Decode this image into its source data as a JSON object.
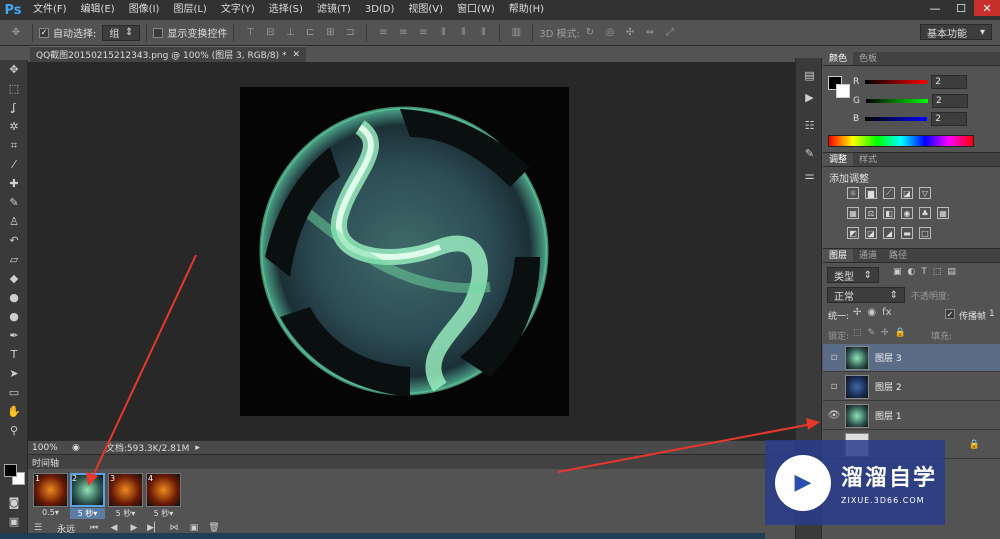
{
  "app": {
    "logo": "Ps",
    "window_controls": [
      "—",
      "☐",
      "✕"
    ]
  },
  "menu": [
    "文件(F)",
    "编辑(E)",
    "图像(I)",
    "图层(L)",
    "文字(Y)",
    "选择(S)",
    "滤镜(T)",
    "3D(D)",
    "视图(V)",
    "窗口(W)",
    "帮助(H)"
  ],
  "options": {
    "auto_select_label": "自动选择:",
    "auto_select_checked": true,
    "auto_select_target": "组",
    "show_transform_label": "显示变换控件",
    "mode_3d_label": "3D 模式:",
    "workspace": "基本功能"
  },
  "document": {
    "tab_title": "QQ截图20150215212343.png @ 100% (图层 3, RGB/8) *",
    "zoom": "100%",
    "doc_size": "文档:593.3K/2.81M"
  },
  "timeline": {
    "title": "时间轴",
    "frames": [
      {
        "num": "1",
        "delay": "0.5▾",
        "selected": false
      },
      {
        "num": "2",
        "delay": "5 秒▾",
        "selected": true
      },
      {
        "num": "3",
        "delay": "5 秒▾",
        "selected": false
      },
      {
        "num": "4",
        "delay": "5 秒▾",
        "selected": false
      }
    ],
    "loop": "永远"
  },
  "color_panel": {
    "tabs": [
      "颜色",
      "色板"
    ],
    "r": "2",
    "g": "2",
    "b": "2",
    "r_label": "R",
    "g_label": "G",
    "b_label": "B"
  },
  "adjust_panel": {
    "tabs": [
      "调整",
      "样式"
    ],
    "title": "添加调整"
  },
  "layers_panel": {
    "tabs": [
      "图层",
      "通道",
      "路径"
    ],
    "filter": "类型",
    "blend_mode": "正常",
    "opacity_label": "不透明度:",
    "unify_label": "统一:",
    "propagate_label": "传播帧",
    "propagate_value": "1",
    "lock_label": "锁定:",
    "fill_label": "填充:",
    "layers": [
      {
        "name": "图层 3",
        "selected": true,
        "visible": false
      },
      {
        "name": "图层 2",
        "selected": false,
        "visible": false
      },
      {
        "name": "图层 1",
        "selected": false,
        "visible": true
      }
    ]
  },
  "watermark": {
    "logo": "▶",
    "title": "溜溜自学",
    "url": "ZIXUE.3D66.COM"
  },
  "colors": {
    "accent": "#5aa3e8",
    "selected_layer": "#5b6d86",
    "arrow": "#e8372c"
  }
}
